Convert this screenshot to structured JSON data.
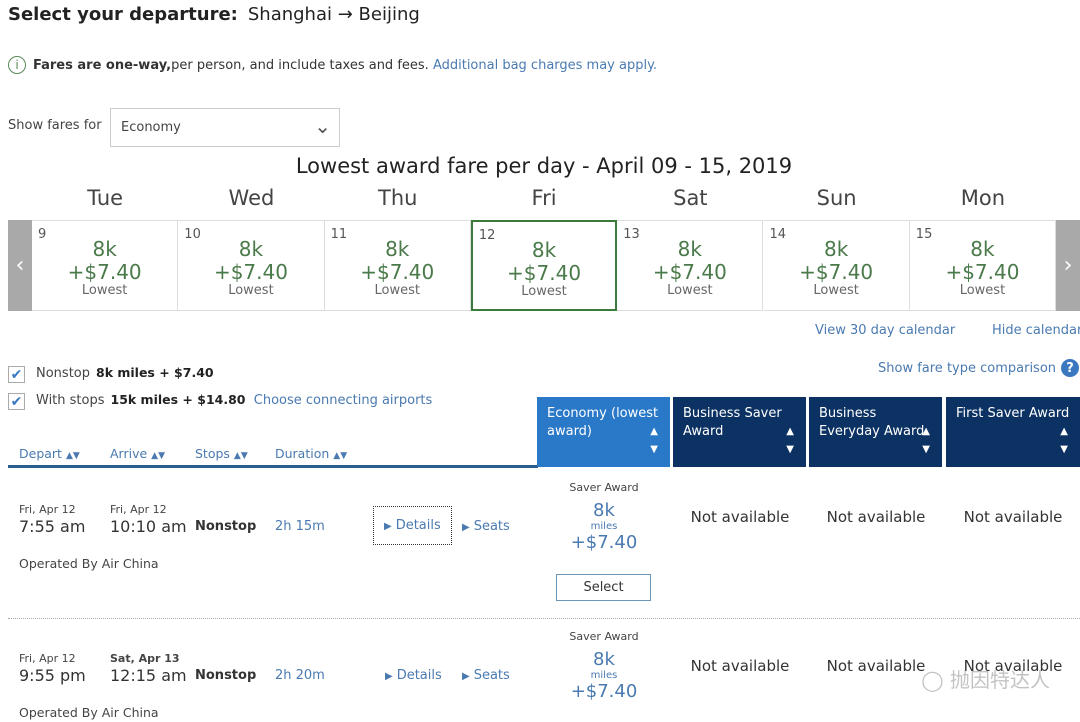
{
  "header": {
    "label": "Select your departure:",
    "route": "Shanghai → Beijing"
  },
  "info": {
    "icon": "info-icon",
    "bold": "Fares are one-way,",
    "text": " per person, and include taxes and fees.",
    "link": "Additional bag charges may apply."
  },
  "fare_select": {
    "label": "Show fares for",
    "value": "Economy"
  },
  "calendar": {
    "title": "Lowest award fare per day - April 09 - 15, 2019",
    "selected_index": 3,
    "days": [
      {
        "name": "Tue",
        "date": "9",
        "miles": "8k",
        "price": "+$7.40",
        "note": "Lowest"
      },
      {
        "name": "Wed",
        "date": "10",
        "miles": "8k",
        "price": "+$7.40",
        "note": "Lowest"
      },
      {
        "name": "Thu",
        "date": "11",
        "miles": "8k",
        "price": "+$7.40",
        "note": "Lowest"
      },
      {
        "name": "Fri",
        "date": "12",
        "miles": "8k",
        "price": "+$7.40",
        "note": "Lowest"
      },
      {
        "name": "Sat",
        "date": "13",
        "miles": "8k",
        "price": "+$7.40",
        "note": "Lowest"
      },
      {
        "name": "Sun",
        "date": "14",
        "miles": "8k",
        "price": "+$7.40",
        "note": "Lowest"
      },
      {
        "name": "Mon",
        "date": "15",
        "miles": "8k",
        "price": "+$7.40",
        "note": "Lowest"
      }
    ],
    "view30": "View 30 day calendar",
    "hide": "Hide calendar"
  },
  "filters": {
    "nonstop": {
      "label": "Nonstop",
      "value": "8k miles + $7.40",
      "checked": true
    },
    "stops": {
      "label": "With stops",
      "value": "15k miles + $14.80",
      "checked": true
    },
    "connecting": "Choose connecting airports",
    "comparison": "Show fare type comparison"
  },
  "sort_headers": [
    "Depart",
    "Arrive",
    "Stops",
    "Duration"
  ],
  "columns": [
    "Economy (lowest award)",
    "Business Saver Award",
    "Business Everyday Award",
    "First Saver Award"
  ],
  "flights": [
    {
      "dep_date": "Fri, Apr 12",
      "dep_time": "7:55 am",
      "arr_date": "Fri, Apr 12",
      "arr_time": "10:10 am",
      "stops": "Nonstop",
      "duration": "2h 15m",
      "operator": "Operated By Air China",
      "details": "Details",
      "seats": "Seats",
      "fare_type": "Saver Award",
      "miles": "8k",
      "miles_label": "miles",
      "price": "+$7.40",
      "select": "Select",
      "na": [
        "Not available",
        "Not available",
        "Not available"
      ]
    },
    {
      "dep_date": "Fri, Apr 12",
      "dep_time": "9:55 pm",
      "arr_date": "Sat, Apr 13",
      "arr_time": "12:15 am",
      "stops": "Nonstop",
      "duration": "2h 20m",
      "operator": "Operated By Air China",
      "details": "Details",
      "seats": "Seats",
      "fare_type": "Saver Award",
      "miles": "8k",
      "miles_label": "miles",
      "price": "+$7.40",
      "na": [
        "Not available",
        "Not available",
        "Not available"
      ]
    }
  ],
  "colors": {
    "accent": "#2a78c8",
    "dark_header": "#0b3262",
    "calendar_green": "#3a7a3a",
    "link": "#4a7ab0"
  },
  "watermark": "抛因特达人"
}
